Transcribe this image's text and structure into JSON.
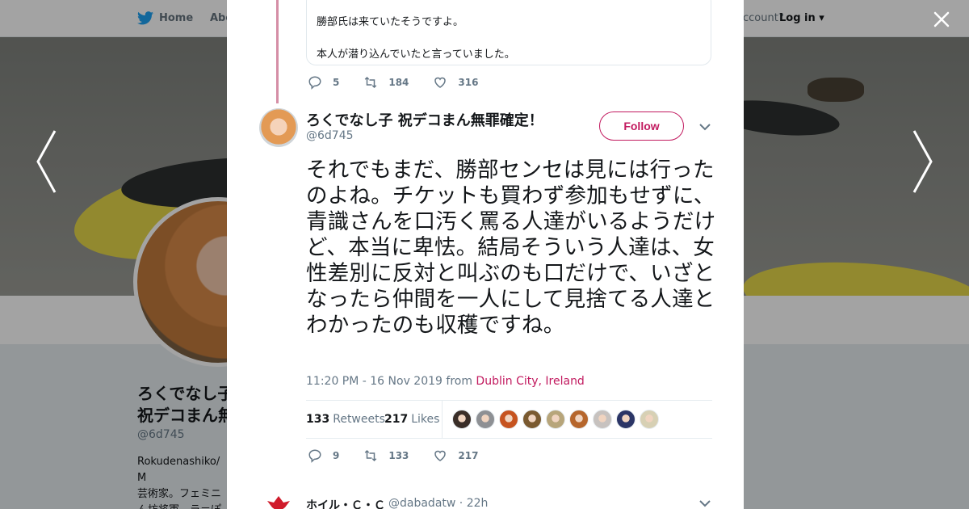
{
  "nav": {
    "home_label": "Home",
    "about_label": "Abo",
    "account_text": "ccount?",
    "login_label": "Log in"
  },
  "background_profile": {
    "name": "ろくでなし子 祝デコまん無罪確定！",
    "handle": "@6d745",
    "bio": "Rokudenashiko/ M\n芸術家。フェミニ\nん坊将軍。ラ＝ぽ\nおゆーこなずん"
  },
  "previous_tweet": {
    "lines": [
      "勝部氏は来ていたそうですよ。",
      "本人が潜り込んでいたと言っていました。"
    ],
    "replies": "5",
    "retweets": "184",
    "likes": "316"
  },
  "tweet": {
    "author_name": "ろくでなし子 祝デコまん無罪確定！",
    "author_handle": "@6d745",
    "follow_label": "Follow",
    "text": "それでもまだ、勝部センセは見には行ったのよね。チケットも買わず参加もせずに、青識さんを口汚く罵る人達がいるようだけど、本当に卑怯。結局そういう人達は、女性差別に反対と叫ぶのも口だけで、いざとなったら仲間を一人にして見捨てる人達とわかったのも収穫ですね。",
    "timestamp": "11:20 PM - 16 Nov 2019 from ",
    "location": "Dublin City, Ireland",
    "retweet_count": "133",
    "retweet_label": "Retweets",
    "like_count": "217",
    "like_label": "Likes",
    "actions": {
      "replies": "9",
      "retweets": "133",
      "likes": "217"
    },
    "liker_colors": [
      "#3a2e28",
      "#8e9094",
      "#c6531f",
      "#7a5a30",
      "#b7a57a",
      "#b6662c",
      "#c7c2bf",
      "#2b3566",
      "#d7d0b4"
    ]
  },
  "next_tweet": {
    "author_name": "ホイル・Ｃ・Ｃ",
    "handle_time": "@dabadatw · 22h"
  },
  "colors": {
    "accent": "#c21a5f",
    "thread_line": "#d58ea6",
    "twitter_blue": "#1da1f2"
  }
}
